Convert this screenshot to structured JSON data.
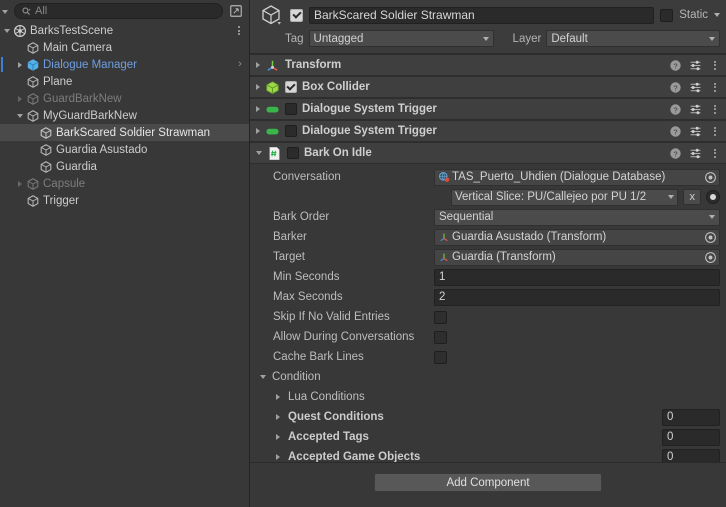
{
  "hierarchy": {
    "search": {
      "placeholder": "All",
      "icon": "search-icon",
      "panel_icon": "panel-layout-icon"
    },
    "items": [
      {
        "label": "BarksTestScene",
        "icon": "scene-icon",
        "indent": 0,
        "twisty": "down",
        "selected": false,
        "dim": false,
        "prefab": false,
        "kebab": true
      },
      {
        "label": "Main Camera",
        "icon": "gameobject-icon",
        "indent": 1,
        "twisty": "none",
        "selected": false,
        "dim": false,
        "prefab": false
      },
      {
        "label": "Dialogue Manager",
        "icon": "prefab-icon",
        "indent": 1,
        "twisty": "right",
        "selected": false,
        "dim": false,
        "prefab": true,
        "marker": true,
        "chevron": true
      },
      {
        "label": "Plane",
        "icon": "gameobject-icon",
        "indent": 1,
        "twisty": "none",
        "selected": false,
        "dim": false,
        "prefab": false
      },
      {
        "label": "GuardBarkNew",
        "icon": "gameobject-icon",
        "indent": 1,
        "twisty": "right",
        "selected": false,
        "dim": true,
        "prefab": false
      },
      {
        "label": "MyGuardBarkNew",
        "icon": "gameobject-icon",
        "indent": 1,
        "twisty": "down",
        "selected": false,
        "dim": false,
        "prefab": false
      },
      {
        "label": "BarkScared Soldier Strawman",
        "icon": "gameobject-icon",
        "indent": 2,
        "twisty": "none",
        "selected": true,
        "dim": false,
        "prefab": false
      },
      {
        "label": "Guardia Asustado",
        "icon": "gameobject-icon",
        "indent": 2,
        "twisty": "none",
        "selected": false,
        "dim": false,
        "prefab": false
      },
      {
        "label": "Guardia",
        "icon": "gameobject-icon",
        "indent": 2,
        "twisty": "none",
        "selected": false,
        "dim": false,
        "prefab": false
      },
      {
        "label": "Capsule",
        "icon": "gameobject-icon",
        "indent": 1,
        "twisty": "right",
        "selected": false,
        "dim": true,
        "prefab": false
      },
      {
        "label": "Trigger",
        "icon": "gameobject-icon",
        "indent": 1,
        "twisty": "none",
        "selected": false,
        "dim": false,
        "prefab": false
      }
    ]
  },
  "inspector": {
    "object_name": "BarkScared Soldier Strawman",
    "enabled": true,
    "static_label": "Static",
    "static_checked": false,
    "tag_label": "Tag",
    "tag_value": "Untagged",
    "layer_label": "Layer",
    "layer_value": "Default",
    "components": [
      {
        "title": "Transform",
        "icon": "transform-icon",
        "expanded": false,
        "has_enable_checkbox": false,
        "enabled": false
      },
      {
        "title": "Box Collider",
        "icon": "box-collider-icon",
        "expanded": false,
        "has_enable_checkbox": true,
        "enabled": true
      },
      {
        "title": "Dialogue System Trigger",
        "icon": "script-capsule-icon",
        "expanded": false,
        "has_enable_checkbox": true,
        "enabled": false
      },
      {
        "title": "Dialogue System Trigger",
        "icon": "script-capsule-icon",
        "expanded": false,
        "has_enable_checkbox": true,
        "enabled": false
      },
      {
        "title": "Bark On Idle",
        "icon": "cs-script-icon",
        "expanded": true,
        "has_enable_checkbox": true,
        "enabled": false
      }
    ],
    "bark_on_idle": {
      "conversation_label": "Conversation",
      "conversation_db": "TAS_Puerto_Uhdien (Dialogue Database)",
      "conversation_value": "Vertical Slice: PU/Callejeo por PU 1/2",
      "clear_button": "x",
      "bark_order_label": "Bark Order",
      "bark_order_value": "Sequential",
      "barker_label": "Barker",
      "barker_value": "Guardia Asustado (Transform)",
      "target_label": "Target",
      "target_value": "Guardia (Transform)",
      "min_seconds_label": "Min Seconds",
      "min_seconds_value": "1",
      "max_seconds_label": "Max Seconds",
      "max_seconds_value": "2",
      "skip_label": "Skip If No Valid Entries",
      "skip_checked": false,
      "allow_label": "Allow During Conversations",
      "allow_checked": false,
      "cache_label": "Cache Bark Lines",
      "cache_checked": false,
      "condition_label": "Condition",
      "condition_rows": [
        {
          "label": "Lua Conditions",
          "count": null,
          "bold": false
        },
        {
          "label": "Quest Conditions",
          "count": "0",
          "bold": true
        },
        {
          "label": "Accepted Tags",
          "count": "0",
          "bold": true
        },
        {
          "label": "Accepted Game Objects",
          "count": "0",
          "bold": true
        }
      ]
    },
    "add_component_label": "Add Component"
  },
  "colors": {
    "panel_bg": "#383838",
    "component_header": "#3f3f3f",
    "selection": "#4a4a4a",
    "prefab_blue": "#6f9fe0",
    "marker_blue": "#3d7fd6",
    "field_bg": "#2a2a2a",
    "popup_bg": "#4b4b4b",
    "button_bg": "#585858"
  }
}
